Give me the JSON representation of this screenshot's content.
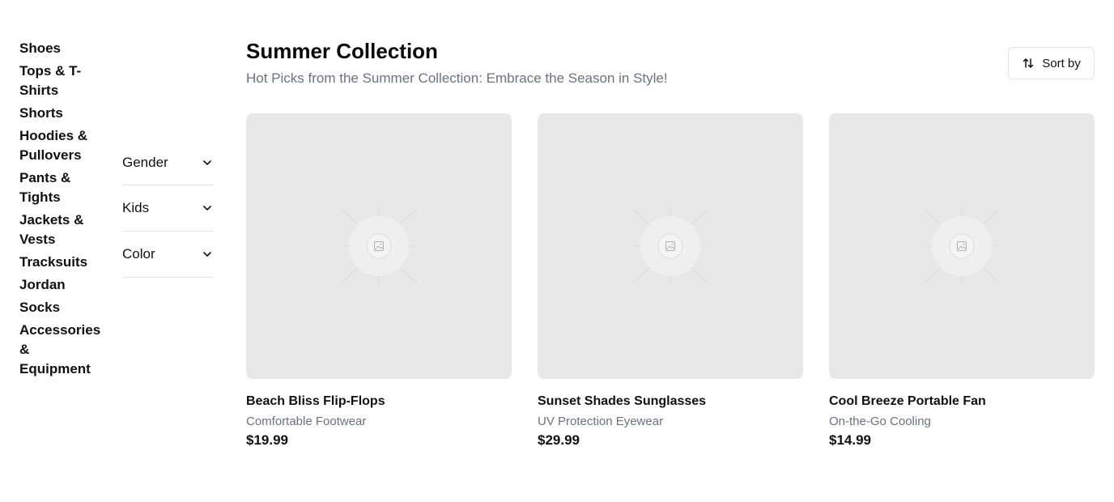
{
  "categories": [
    {
      "label": "Shoes"
    },
    {
      "label": "Tops & T-Shirts"
    },
    {
      "label": "Shorts"
    },
    {
      "label": "Hoodies & Pullovers"
    },
    {
      "label": "Pants & Tights"
    },
    {
      "label": "Jackets & Vests"
    },
    {
      "label": "Tracksuits"
    },
    {
      "label": "Jordan"
    },
    {
      "label": "Socks"
    },
    {
      "label": "Accessories & Equipment"
    }
  ],
  "filters": [
    {
      "label": "Gender",
      "icon": "chevron-down-icon"
    },
    {
      "label": "Kids",
      "icon": "chevron-down-icon"
    },
    {
      "label": "Color",
      "icon": "chevron-down-icon"
    }
  ],
  "header": {
    "title": "Summer Collection",
    "subtitle": "Hot Picks from the Summer Collection: Embrace the Season in Style!"
  },
  "sort": {
    "label": "Sort by",
    "icon": "sort-arrows-icon"
  },
  "products": [
    {
      "name": "Beach Bliss Flip-Flops",
      "description": "Comfortable Footwear",
      "price": "$19.99",
      "image_icon": "image-placeholder-icon"
    },
    {
      "name": "Sunset Shades Sunglasses",
      "description": "UV Protection Eyewear",
      "price": "$29.99",
      "image_icon": "image-placeholder-icon"
    },
    {
      "name": "Cool Breeze Portable Fan",
      "description": "On-the-Go Cooling",
      "price": "$14.99",
      "image_icon": "image-placeholder-icon"
    }
  ],
  "colors": {
    "text": "#111111",
    "muted": "#6b7280",
    "placeholder_bg": "#e8e8e8",
    "border": "#e5e5e5"
  }
}
